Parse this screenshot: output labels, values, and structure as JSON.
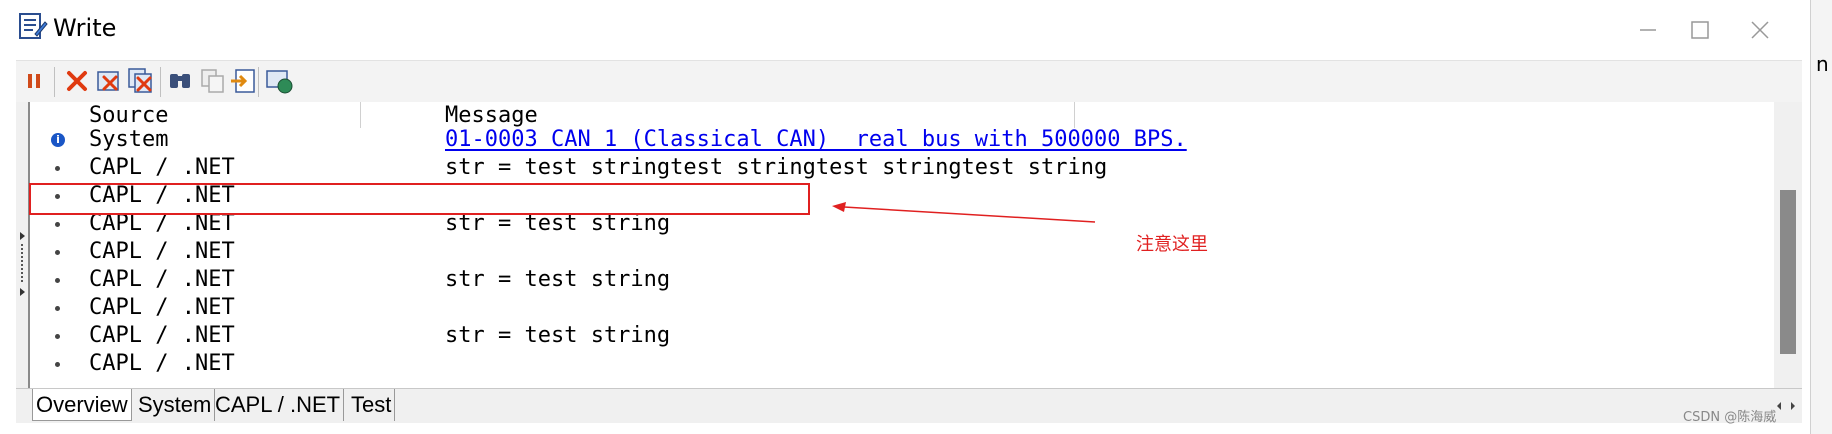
{
  "window": {
    "title": "Write"
  },
  "columns": {
    "source": "Source",
    "message": "Message"
  },
  "rows": [
    {
      "icon": "info-icon",
      "source": "System",
      "message": "01-0003 CAN 1 (Classical CAN)  real bus with 500000 BPS.",
      "is_link": true
    },
    {
      "icon": "bullet-icon",
      "source": "CAPL / .NET",
      "message": "str = test stringtest stringtest stringtest string",
      "is_link": false
    },
    {
      "icon": "bullet-icon",
      "source": "CAPL / .NET",
      "message": "",
      "is_link": false
    },
    {
      "icon": "bullet-icon",
      "source": "CAPL / .NET",
      "message": "str = test string",
      "is_link": false
    },
    {
      "icon": "bullet-icon",
      "source": "CAPL / .NET",
      "message": "",
      "is_link": false
    },
    {
      "icon": "bullet-icon",
      "source": "CAPL / .NET",
      "message": "str = test string",
      "is_link": false
    },
    {
      "icon": "bullet-icon",
      "source": "CAPL / .NET",
      "message": "",
      "is_link": false
    },
    {
      "icon": "bullet-icon",
      "source": "CAPL / .NET",
      "message": "str = test string",
      "is_link": false
    },
    {
      "icon": "bullet-icon",
      "source": "CAPL / .NET",
      "message": "",
      "is_link": false
    }
  ],
  "tabs": [
    {
      "label": "Overview",
      "active": true
    },
    {
      "label": "System",
      "active": false
    },
    {
      "label": "CAPL / .NET",
      "active": false
    },
    {
      "label": "Test",
      "active": false
    }
  ],
  "toolbar": {
    "buttons": [
      "pause-icon",
      "clear-icon",
      "delete-icon",
      "delete-all-icon",
      "find-icon",
      "copy-icon",
      "export-icon",
      "options-icon"
    ]
  },
  "annotation": {
    "text": "注意这里"
  },
  "watermark": "CSDN @陈海威",
  "right_edge_glyph": "n",
  "colors": {
    "link": "#0000ee",
    "annotation": "#e02020",
    "info": "#1a56c6"
  }
}
